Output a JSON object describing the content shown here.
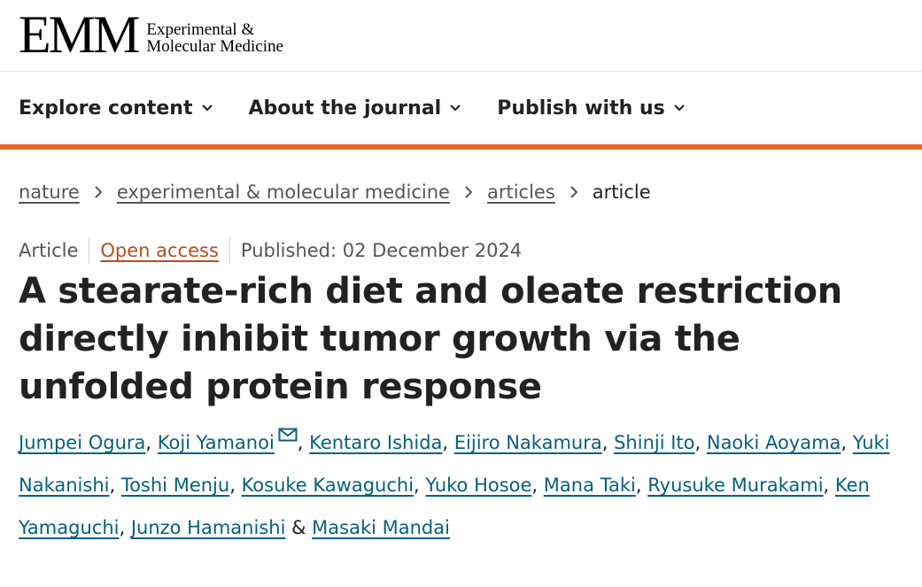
{
  "header": {
    "logo_mark": "EMM",
    "logo_line1": "Experimental &",
    "logo_line2": "Molecular Medicine"
  },
  "nav": {
    "items": [
      {
        "label": "Explore content"
      },
      {
        "label": "About the journal"
      },
      {
        "label": "Publish with us"
      }
    ]
  },
  "breadcrumbs": {
    "items": [
      "nature",
      "experimental & molecular medicine",
      "articles"
    ],
    "current": "article"
  },
  "meta": {
    "type": "Article",
    "access": "Open access",
    "published": "Published: 02 December 2024"
  },
  "title": "A stearate-rich diet and oleate restriction directly inhibit tumor growth via the unfolded protein response",
  "authors": [
    "Jumpei Ogura",
    "Koji Yamanoi",
    "Kentaro Ishida",
    "Eijiro Nakamura",
    "Shinji Ito",
    "Naoki Aoyama",
    "Yuki Nakanishi",
    "Toshi Menju",
    "Kosuke Kawaguchi",
    "Yuko Hosoe",
    "Mana Taki",
    "Ryusuke Murakami",
    "Ken Yamaguchi",
    "Junzo Hamanishi",
    "Masaki Mandai"
  ],
  "author_separator": ", ",
  "author_last_separator": " & ",
  "colors": {
    "accent_bar": "#e8692d",
    "open_access": "#b5501f",
    "author_link": "#06607f"
  }
}
